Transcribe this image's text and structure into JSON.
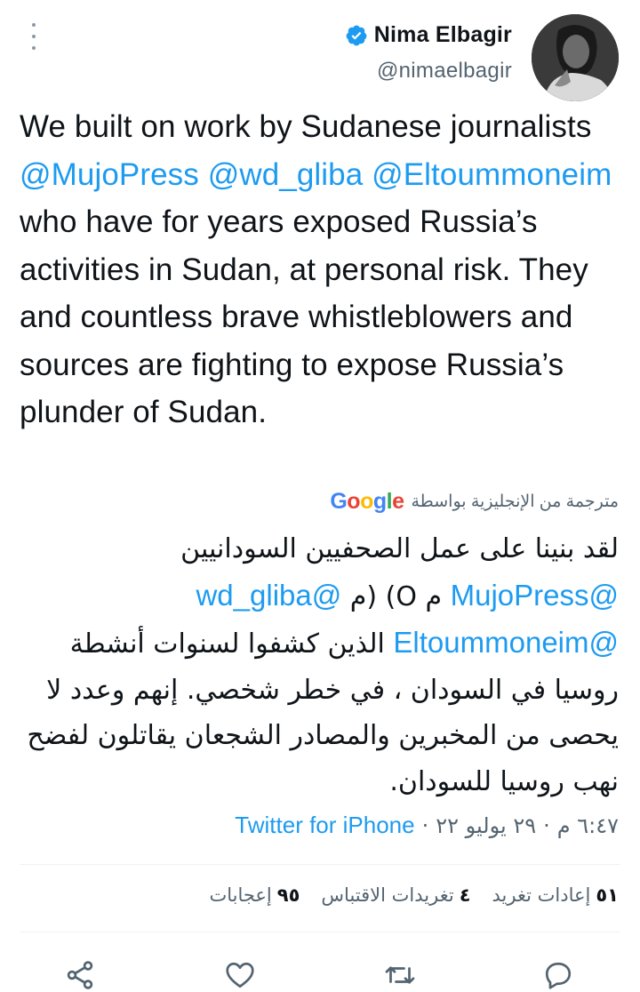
{
  "author": {
    "display_name": "Nima Elbagir",
    "handle": "@nimaelbagir",
    "avatar_alt": "profile-photo"
  },
  "tweet": {
    "segments": [
      {
        "text": "We built on work by Sudanese journalists ",
        "type": "text"
      },
      {
        "text": "@MujoPress",
        "type": "mention"
      },
      {
        "text": " ",
        "type": "text"
      },
      {
        "text": "@wd_gliba",
        "type": "mention"
      },
      {
        "text": " ",
        "type": "text"
      },
      {
        "text": "@Eltoummoneim",
        "type": "mention"
      },
      {
        "text": " who have for years exposed Russia’s activities in Sudan, at personal risk. They and countless brave whistleblowers and sources are fighting to expose Russia’s plunder of Sudan.",
        "type": "text"
      }
    ]
  },
  "translation": {
    "label": "مترجمة من الإنجليزية بواسطة",
    "provider": "Google",
    "line1": "لقد بنينا على عمل الصحفيين السودانيين",
    "line2_mention1": "@MujoPress",
    "line2_text": "م O) (م",
    "line2_mention2": "@wd_gliba",
    "line3_mention": "@Eltoummoneim",
    "line3_text": "الذين كشفوا لسنوات أنشطة",
    "line4": "روسيا في السودان ، في خطر شخصي. إنهم وعدد لا",
    "line5": "يحصى من المخبرين والمصادر الشجعان يقاتلون لفضح",
    "line6": "نهب روسيا للسودان."
  },
  "meta": {
    "time": "٦:٤٧ م",
    "separator": "·",
    "date": "٢٩ يوليو ٢٢",
    "source": "Twitter for iPhone"
  },
  "stats": {
    "retweets_count": "٥١",
    "retweets_label": "إعادات تغريد",
    "quotes_count": "٤",
    "quotes_label": "تغريدات الاقتباس",
    "likes_count": "٩٥",
    "likes_label": "إعجابات"
  },
  "colors": {
    "link": "#1d9bf0",
    "secondary_text": "#536471",
    "primary_text": "#0f1419"
  },
  "icons": {
    "more": "more-vertical-icon",
    "verified": "verified-badge-icon",
    "share": "share-icon",
    "like": "heart-icon",
    "retweet": "retweet-icon",
    "reply": "reply-icon"
  }
}
